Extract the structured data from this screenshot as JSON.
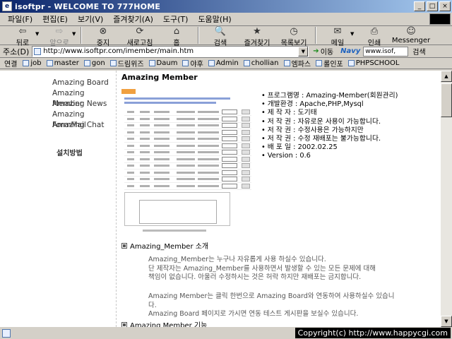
{
  "window": {
    "title": "isoftpr - WELCOME TO 777HOME"
  },
  "menu": [
    "파일(F)",
    "편집(E)",
    "보기(V)",
    "즐겨찾기(A)",
    "도구(T)",
    "도움말(H)"
  ],
  "toolbar": [
    {
      "label": "뒤로",
      "icon": "back-arrow-icon",
      "glyph": "⇦",
      "disabled": false,
      "dropdown": true
    },
    {
      "label": "앞으로",
      "icon": "forward-arrow-icon",
      "glyph": "⇨",
      "disabled": true,
      "dropdown": true
    },
    {
      "label": "중지",
      "icon": "stop-icon",
      "glyph": "⊗",
      "disabled": false,
      "dropdown": false
    },
    {
      "label": "새로고침",
      "icon": "refresh-icon",
      "glyph": "⟳",
      "disabled": false,
      "dropdown": false
    },
    {
      "label": "홈",
      "icon": "home-icon",
      "glyph": "⌂",
      "disabled": false,
      "dropdown": false
    },
    {
      "label": "검색",
      "icon": "search-icon",
      "glyph": "🔍",
      "disabled": false,
      "dropdown": false
    },
    {
      "label": "즐겨찾기",
      "icon": "favorites-icon",
      "glyph": "★",
      "disabled": false,
      "dropdown": false
    },
    {
      "label": "목록보기",
      "icon": "history-icon",
      "glyph": "◷",
      "disabled": false,
      "dropdown": false
    },
    {
      "label": "메일",
      "icon": "mail-icon",
      "glyph": "✉",
      "disabled": false,
      "dropdown": true
    },
    {
      "label": "인쇄",
      "icon": "print-icon",
      "glyph": "⎙",
      "disabled": false,
      "dropdown": false
    },
    {
      "label": "Messenger",
      "icon": "messenger-icon",
      "glyph": "☺",
      "disabled": false,
      "dropdown": false
    }
  ],
  "address": {
    "label": "주소(D)",
    "url": "http://www.isoftpr.com/imember/main.htm",
    "go_label": "이동"
  },
  "naver": {
    "logo": "Navy",
    "value": "www.isof,",
    "search_label": "검색"
  },
  "links": {
    "label": "연결",
    "items": [
      "job",
      "master",
      "gon",
      "드림위즈",
      "Daum",
      "야후",
      "Admin",
      "chollian",
      "엠파스",
      "롤인포",
      "PHPSCHOOL"
    ]
  },
  "sidebar": {
    "items": [
      "Amazing Board",
      "Amazing Member",
      "Amazing News",
      "Amazing FormMail",
      "Amazing Chat"
    ],
    "install_label": "설치방법"
  },
  "main": {
    "title": "Amazing Member",
    "info": [
      {
        "bullet": "•",
        "text": "프로그램명 : Amazing-Member(회원관리)"
      },
      {
        "bullet": "•",
        "text": "개발환경 : Apache,PHP,Mysql"
      },
      {
        "bullet": "•",
        "text": "제 작 자 : 도기태"
      },
      {
        "bullet": "•",
        "text": "저 작 권 : 자유로운 사용이 가능합니다."
      },
      {
        "bullet": "•",
        "text": "저 작 권 : 수정사용은 가능하지만"
      },
      {
        "bullet": "•",
        "text": "저 작 권 : 수정 재배포는 불가능합니다."
      },
      {
        "bullet": "•",
        "text": "배 포 일 : 2002.02.25"
      },
      {
        "bullet": "•",
        "text": "Version : 0.6"
      }
    ],
    "section1_title": "Amazing_Member 소개",
    "para1": [
      "Amazing_Member는 누구나 자유롭게 사용 하실수 있습니다.",
      "단 제작자는 Amazing_Member를 사용하면서 발생할 수 있는 모든 문제에 대해",
      "책임이 없습니다. 아울러 수정하시는 것은 허락 하지만 재배포는 금지합니다."
    ],
    "para2": [
      "Amazing Member는 클릭 한번으로 Amazing Board와 연동하여 사용하실수 있습니다.",
      "Amazing Board 페이지로 가시면 연동 테스트 게시판을 보실수 있습니다."
    ],
    "section2_title": "Amazing Member 기능"
  },
  "status": {
    "copyright": "Copyright(c) http://www.happycgi.com"
  }
}
